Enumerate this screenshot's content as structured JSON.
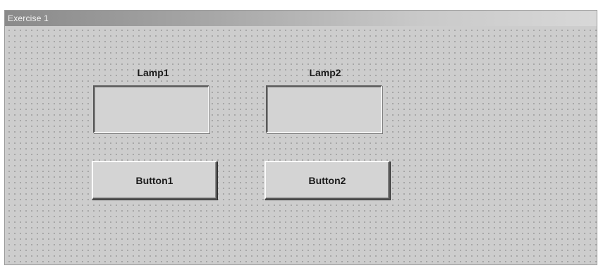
{
  "window": {
    "title": "Exercise 1"
  },
  "lamps": [
    {
      "label": "Lamp1"
    },
    {
      "label": "Lamp2"
    }
  ],
  "buttons": [
    {
      "label": "Button1"
    },
    {
      "label": "Button2"
    }
  ],
  "colors": {
    "form_background": "#cdcdcd",
    "grid_dot": "#9c9c9c",
    "lamp_fill": "#d3d3d3",
    "button_face": "#d4d4d4"
  }
}
